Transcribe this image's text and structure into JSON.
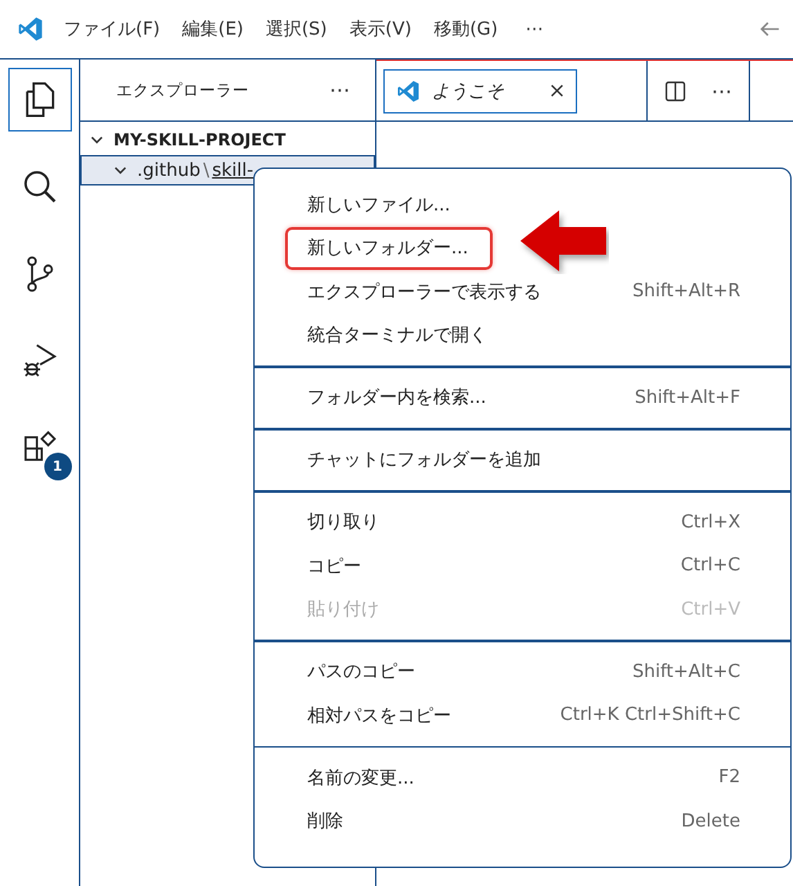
{
  "menubar": {
    "items": [
      "ファイル(F)",
      "編集(E)",
      "選択(S)",
      "表示(V)",
      "移動(G)"
    ],
    "more": "⋯"
  },
  "activity_bar": {
    "items": [
      {
        "selected": true
      },
      {
        "selected": false
      },
      {
        "selected": false
      },
      {
        "selected": false
      },
      {
        "selected": false,
        "badge": "1"
      }
    ]
  },
  "sidebar": {
    "title": "エクスプローラー",
    "more": "⋯",
    "tree": [
      {
        "label": "MY-SKILL-PROJECT",
        "expanded": true,
        "selected": false,
        "children": [
          {
            "label": ".github",
            "separator": "\\",
            "label_2": "skill-",
            "expanded": true,
            "selected": true
          }
        ]
      }
    ]
  },
  "editor": {
    "tab": {
      "label": "ようこそ",
      "selected": true
    },
    "more": "⋯"
  },
  "context_menu": {
    "groups": [
      [
        {
          "label": "新しいファイル...",
          "disabled": false,
          "highlighted": false
        },
        {
          "label": "新しいフォルダー...",
          "disabled": false,
          "highlighted": true
        },
        {
          "label": "エクスプローラーで表示する",
          "shortcut": "Shift+Alt+R",
          "disabled": false,
          "highlighted": false
        },
        {
          "label": "統合ターミナルで開く",
          "disabled": false,
          "highlighted": false
        }
      ],
      [
        {
          "label": "フォルダー内を検索...",
          "shortcut": "Shift+Alt+F",
          "disabled": false,
          "highlighted": false
        }
      ],
      [
        {
          "label": "チャットにフォルダーを追加",
          "disabled": false,
          "highlighted": false
        }
      ],
      [
        {
          "label": "切り取り",
          "shortcut": "Ctrl+X",
          "disabled": false,
          "highlighted": false
        },
        {
          "label": "コピー",
          "shortcut": "Ctrl+C",
          "disabled": false,
          "highlighted": false
        },
        {
          "label": "貼り付け",
          "shortcut": "Ctrl+V",
          "disabled": true,
          "highlighted": false
        }
      ],
      [
        {
          "label": "パスのコピー",
          "shortcut": "Shift+Alt+C",
          "disabled": false,
          "highlighted": false
        },
        {
          "label": "相対パスをコピー",
          "shortcut": "Ctrl+K Ctrl+Shift+C",
          "disabled": false,
          "highlighted": false
        }
      ],
      [
        {
          "label": "名前の変更...",
          "shortcut": "F2",
          "disabled": false,
          "highlighted": false
        },
        {
          "label": "削除",
          "shortcut": "Delete",
          "disabled": false,
          "highlighted": false
        }
      ]
    ]
  }
}
